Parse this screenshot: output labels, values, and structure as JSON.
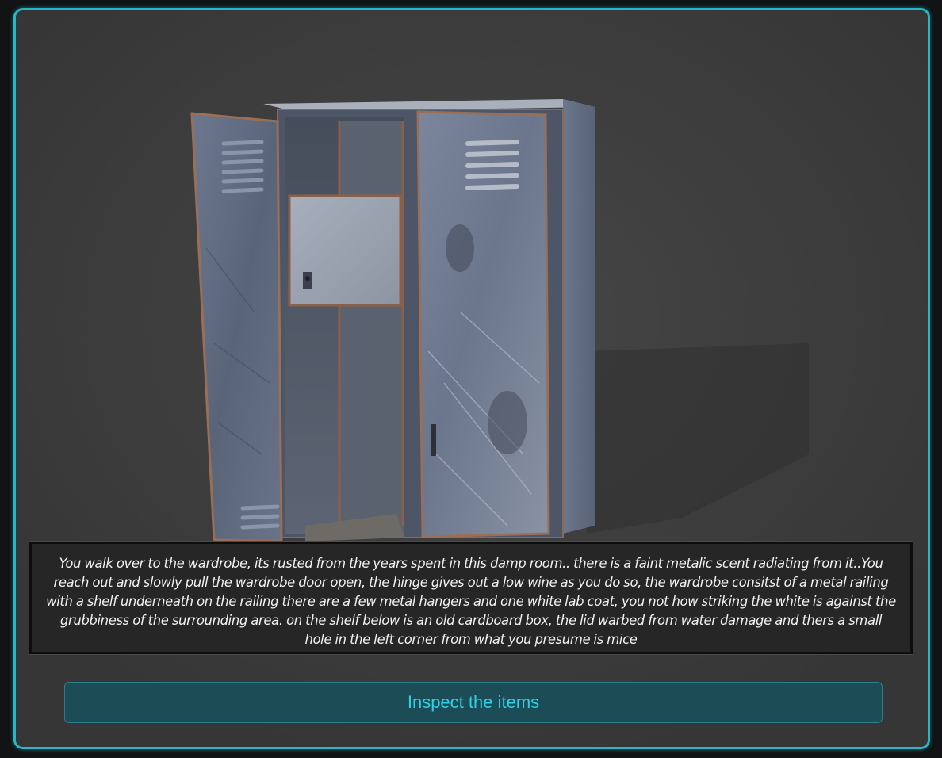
{
  "scene": {
    "subject": "metal wardrobe",
    "icon": "wardrobe-illustration"
  },
  "narration": {
    "text": "You walk over to the wardrobe, its rusted from the years spent in this damp room.. there is a faint metalic scent radiating from it..You reach out and slowly pull the wardrobe door open, the hinge gives out a low wine as you do so, the wardrobe consitst of a metal railing with a shelf underneath on the railing there are a few metal hangers and one white lab coat, you not how striking the white is against the grubbiness of the surrounding area. on the shelf below is an old cardboard box, the lid warbed from water damage and thers a small hole in the left corner from what you presume is mice"
  },
  "actions": {
    "inspect_label": "Inspect the items"
  },
  "colors": {
    "frame_border": "#27b6c8",
    "panel_bg": "#3a3a3a",
    "button_bg": "#1c4d57",
    "button_text": "#2fd1e6"
  }
}
